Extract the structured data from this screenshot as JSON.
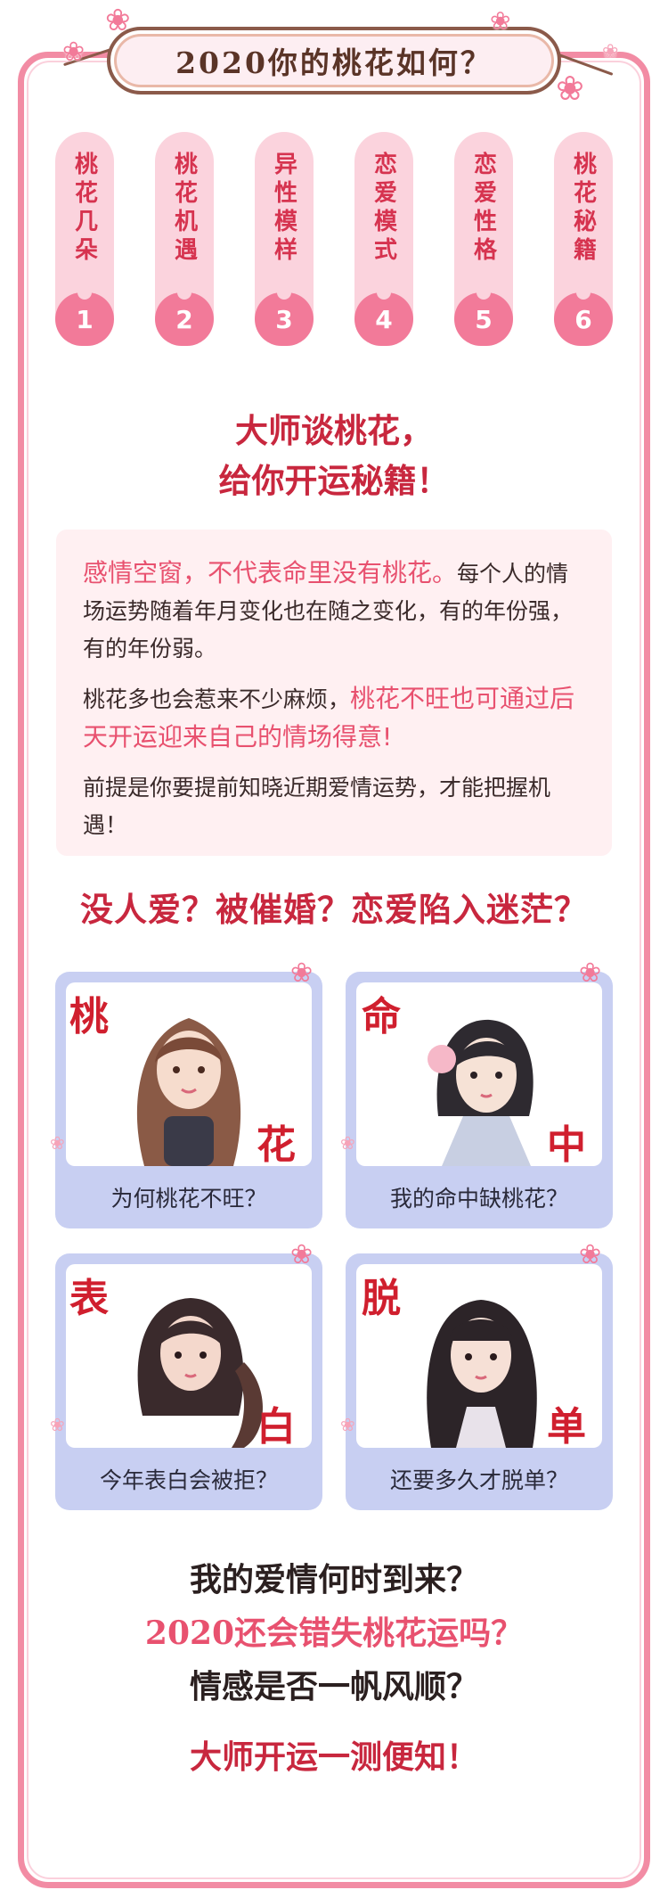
{
  "banner": {
    "title": "2020你的桃花如何？"
  },
  "tabs": [
    {
      "label": "桃花几朵",
      "num": "1"
    },
    {
      "label": "桃花机遇",
      "num": "2"
    },
    {
      "label": "异性模样",
      "num": "3"
    },
    {
      "label": "恋爱模式",
      "num": "4"
    },
    {
      "label": "恋爱性格",
      "num": "5"
    },
    {
      "label": "桃花秘籍",
      "num": "6"
    }
  ],
  "master": {
    "line1": "大师谈桃花，",
    "line2": "给你开运秘籍！"
  },
  "info": {
    "p1_highlight": "感情空窗，不代表命里没有桃花。",
    "p1_text": "每个人的情场运势随着年月变化也在随之变化，有的年份强，有的年份弱。",
    "p2_text": "桃花多也会惹来不少麻烦，",
    "p2_highlight": "桃花不旺也可通过后天开运迎来自己的情场得意!",
    "p3_text": "前提是你要提前知晓近期爱情运势，才能把握机遇！"
  },
  "question": "没人爱？被催婚？恋爱陷入迷茫？",
  "cards": [
    {
      "char1": "桃",
      "char2": "花",
      "caption": "为何桃花不旺？"
    },
    {
      "char1": "命",
      "char2": "中",
      "caption": "我的命中缺桃花？"
    },
    {
      "char1": "表",
      "char2": "白",
      "caption": "今年表白会被拒？"
    },
    {
      "char1": "脱",
      "char2": "单",
      "caption": "还要多久才脱单？"
    }
  ],
  "closing": {
    "line1": "我的爱情何时到来？",
    "line2": "2020还会错失桃花运吗？",
    "line3": "情感是否一帆风顺？"
  },
  "slogan": "大师开运一测便知！",
  "colors": {
    "accent": "#f27a99",
    "title_red": "#c8273e",
    "card_blue": "#c8cff2",
    "info_bg": "#fff0f2"
  },
  "icons": {
    "blossom": "cherry-blossom-icon"
  }
}
